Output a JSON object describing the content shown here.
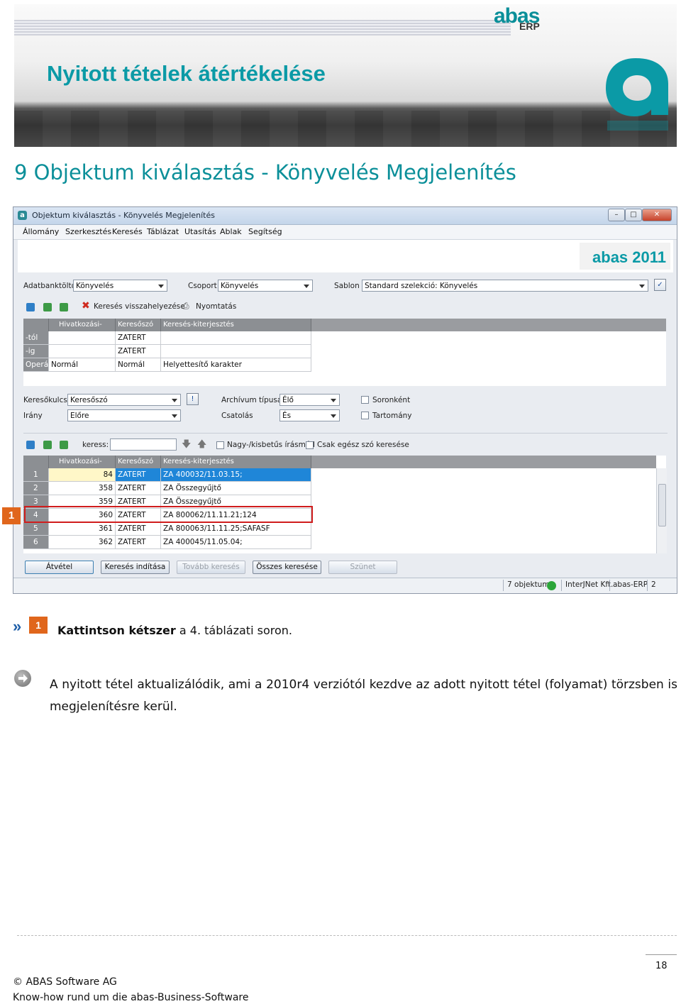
{
  "banner": {
    "title": "Nyitott tételek átértékelése",
    "logo_text": "abas",
    "logo_sub": "ERP",
    "accent": "#0b9aa6"
  },
  "section_heading": "9 Objektum kiválasztás - Könyvelés Megjelenítés",
  "window": {
    "title": "Objektum kiválasztás - Könyvelés Megjelenítés",
    "menu": [
      "Állomány",
      "Szerkesztés",
      "Keresés",
      "Táblázat",
      "Utasítás",
      "Ablak",
      "Segítség"
    ],
    "brand": "abas 2011",
    "filter_row": {
      "db_label": "Adatbanktöltő",
      "db_value": "Könyvelés",
      "group_label": "Csoport",
      "group_value": "Könyvelés",
      "template_label": "Sablon",
      "template_value": "Standard szelekció: Könyvelés"
    },
    "toolbar1": {
      "reset": "Keresés visszahelyezése",
      "print": "Nyomtatás"
    },
    "criteria_grid": {
      "headers": [
        "Hivatkozási-szám",
        "Keresőszó",
        "Keresés-kiterjesztés"
      ],
      "rows": [
        {
          "label": "-tól",
          "ref": "",
          "key": "ZATERT",
          "ext": ""
        },
        {
          "label": "-ig",
          "ref": "",
          "key": "ZATERT",
          "ext": ""
        },
        {
          "label": "Operá",
          "ref": "Normál",
          "key": "Normál",
          "ext": "Helyettesítő karakter"
        }
      ]
    },
    "options": {
      "keyfield_label": "Keresőkulcs",
      "keyfield_value": "Keresőszó",
      "direction_label": "Irány",
      "direction_value": "Előre",
      "archive_label": "Archívum típusa",
      "archive_value": "Élő",
      "links_label": "Csatolás",
      "links_value": "És",
      "rowwise_label": "Soronként",
      "range_label": "Tartomány"
    },
    "toolbar2": {
      "search_label": "keress:",
      "search_value": "",
      "case_label": "Nagy-/kisbetűs írásmód",
      "whole_word_label": "Csak egész szó keresése"
    },
    "results": {
      "headers": [
        "Hivatkozási-szám",
        "Keresőszó",
        "Keresés-kiterjesztés"
      ],
      "rows": [
        {
          "n": "1",
          "ref": "84",
          "key": "ZATERT",
          "ext": "ZA 400032/11.03.15;"
        },
        {
          "n": "2",
          "ref": "358",
          "key": "ZATERT",
          "ext": "ZA Összegyűjtő"
        },
        {
          "n": "3",
          "ref": "359",
          "key": "ZATERT",
          "ext": "ZA Összegyűjtő"
        },
        {
          "n": "4",
          "ref": "360",
          "key": "ZATERT",
          "ext": "ZA 800062/11.11.21;124"
        },
        {
          "n": "5",
          "ref": "361",
          "key": "ZATERT",
          "ext": "ZA 800063/11.11.25;SAFASF"
        },
        {
          "n": "6",
          "ref": "362",
          "key": "ZATERT",
          "ext": "ZA 400045/11.05.04;"
        }
      ]
    },
    "buttons": {
      "accept": "Átvétel",
      "start": "Keresés indítása",
      "more": "Tovább keresés",
      "all": "Összes keresése",
      "pause": "Szünet"
    },
    "status": {
      "count": "7 objektum",
      "company": "InterJNet Kft.",
      "app": "abas-ERP",
      "num": "2"
    }
  },
  "callout_number": "1",
  "instruction": {
    "marker": "1",
    "bold": "Kattintson kétszer",
    "rest": " a 4. táblázati soron."
  },
  "note": "A nyitott tétel aktualizálódik, ami a 2010r4 verziótól kezdve az adott nyitott tétel (folyamat) törzsben is megjelenítésre kerül.",
  "footer": {
    "page": "18",
    "line1": "© ABAS Software AG",
    "line2": "Know-how rund um die abas-Business-Software"
  }
}
